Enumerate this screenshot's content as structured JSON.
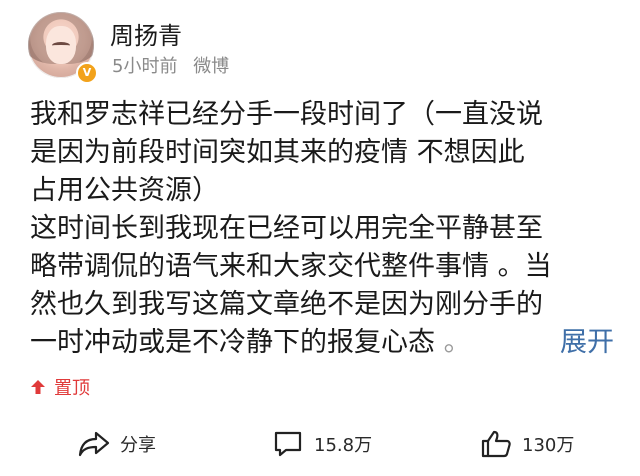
{
  "post": {
    "author": "周扬青",
    "time": "5小时前",
    "source": "微博",
    "verified_icon": "verified-badge-icon",
    "content_lines": [
      "我和罗志祥已经分手一段时间了（一直没说",
      "是因为前段时间突如其来的疫情 不想因此",
      "占用公共资源）",
      "这时间长到我现在已经可以用完全平静甚至",
      "略带调侃的语气来和大家交代整件事情 。当",
      "然也久到我写这篇文章绝不是因为刚分手的",
      "一时冲动或是不冷静下的报复心态"
    ],
    "ellipsis": "。",
    "expand_label": "展开",
    "pin_label": "置顶"
  },
  "actions": {
    "share_label": "分享",
    "comment_count": "15.8万",
    "like_count": "130万"
  },
  "colors": {
    "accent_link": "#3f6fa8",
    "pin_red": "#e03a3a",
    "verified_orange": "#f2a21b",
    "meta_gray": "#8a8a8a"
  }
}
